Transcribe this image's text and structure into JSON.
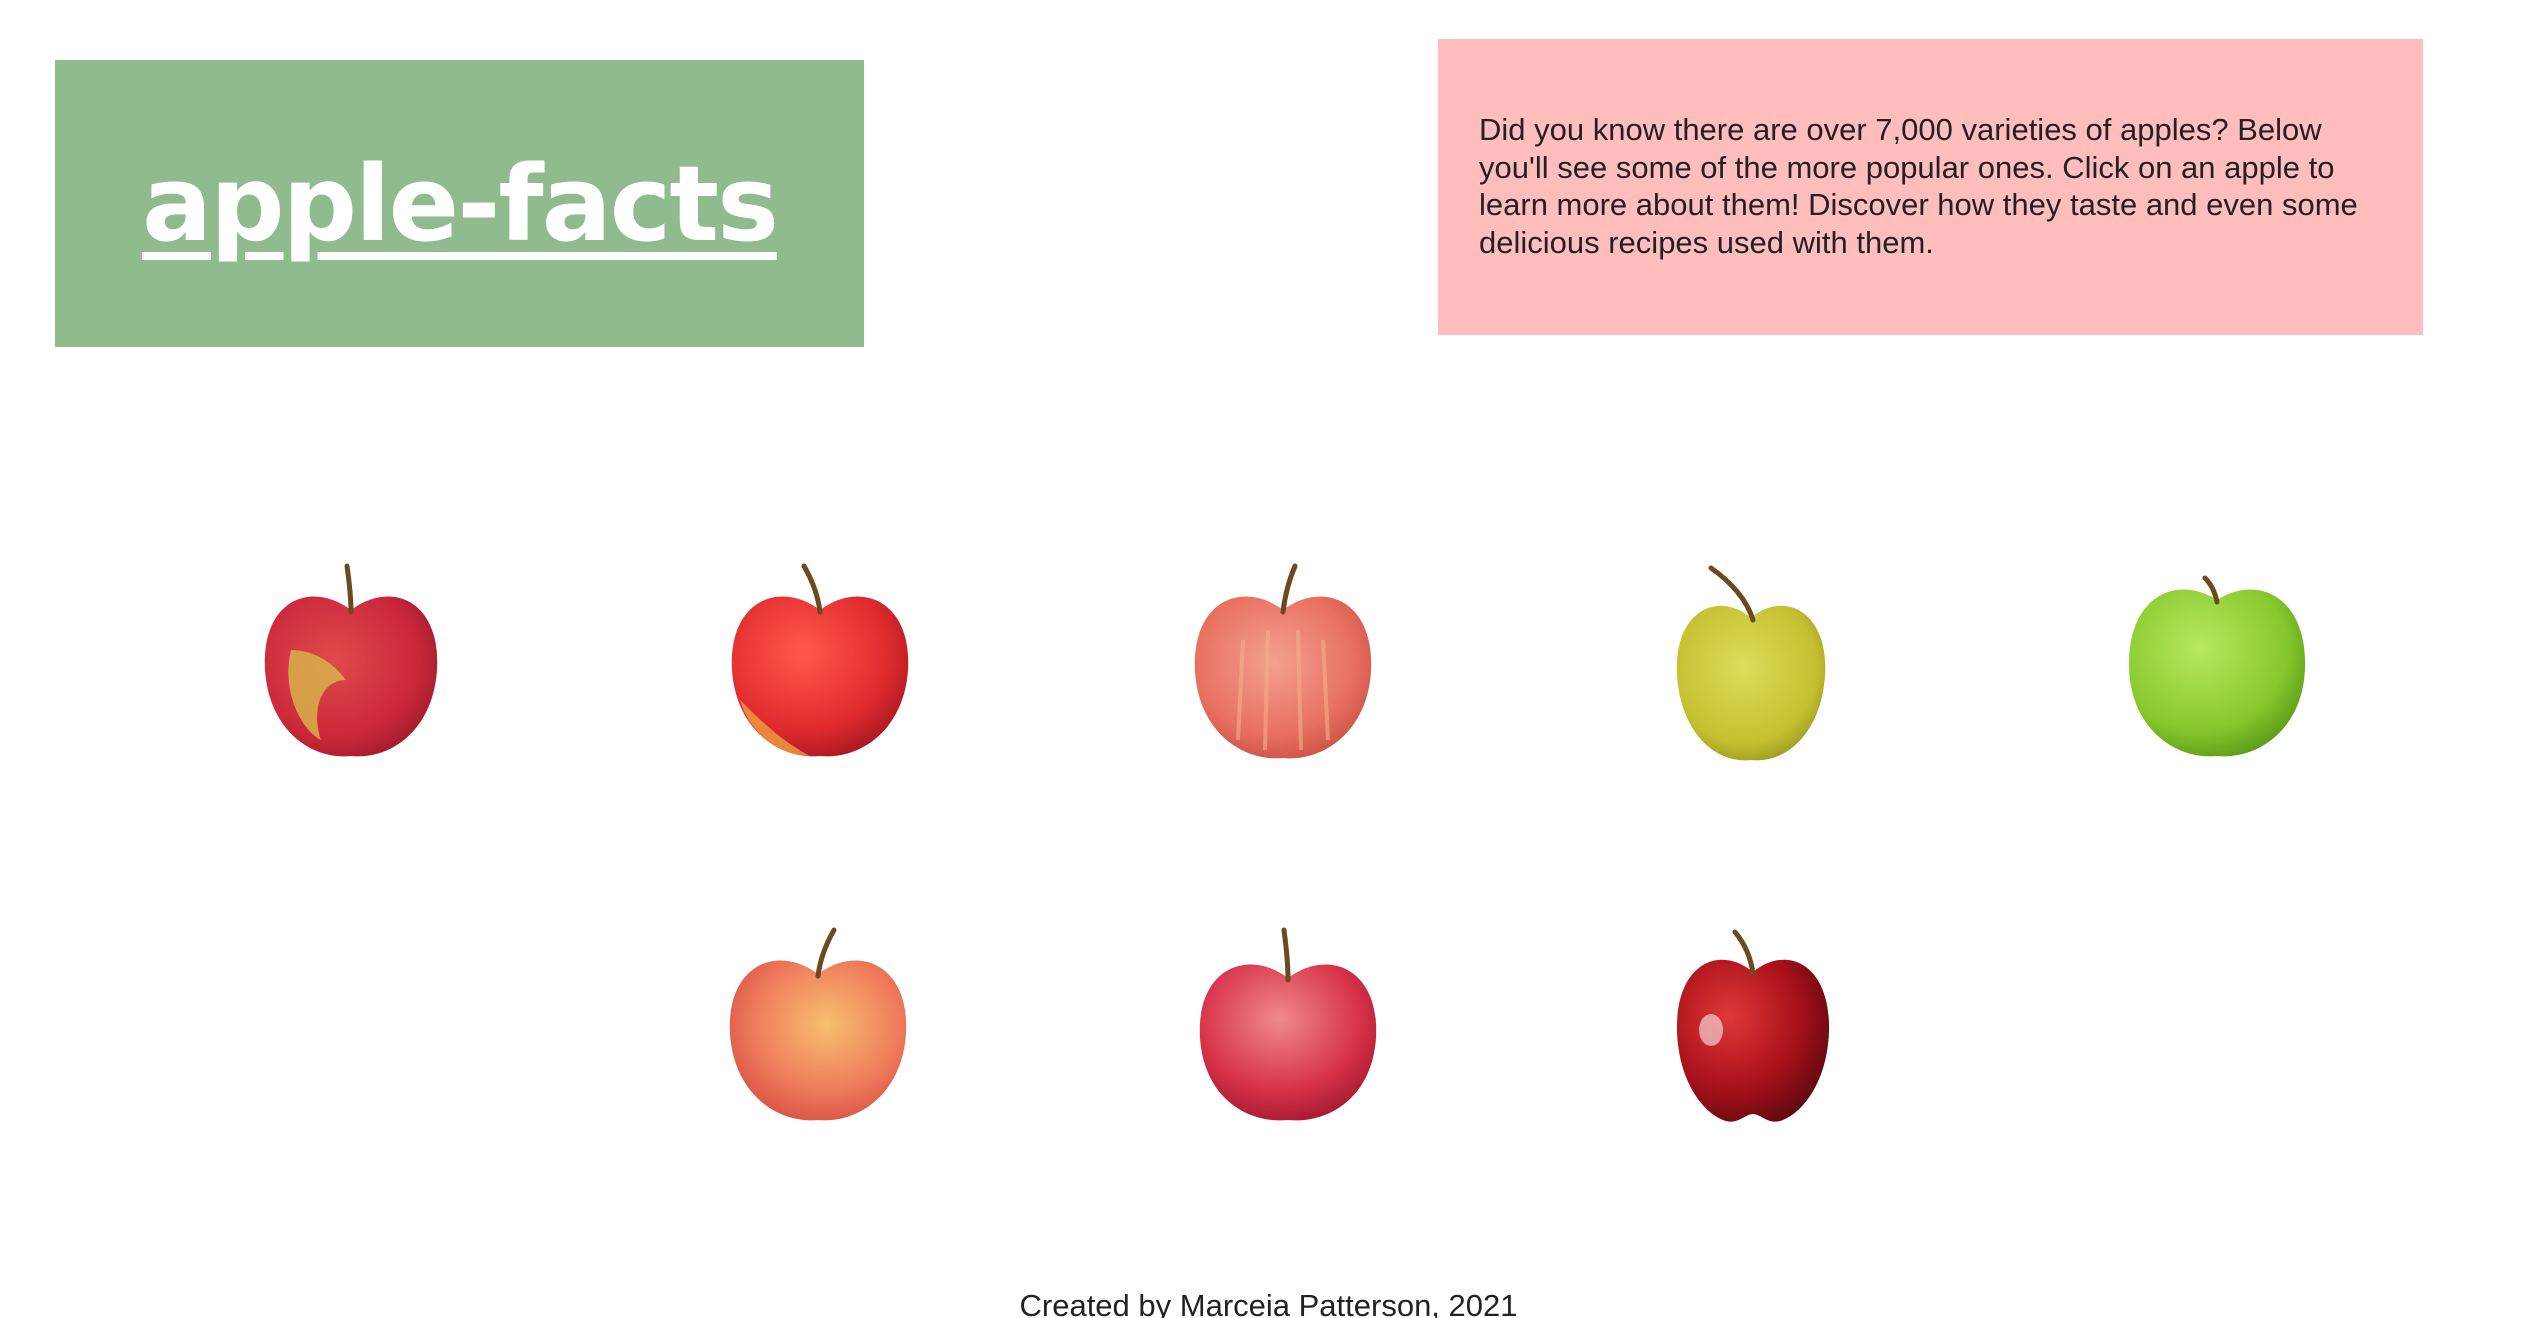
{
  "header": {
    "title": "apple-facts"
  },
  "intro": {
    "text": "Did you know there are over 7,000 varieties of apples? Below you'll see some of the more popular ones. Click on an apple to learn more about them! Discover how they taste and even some delicious recipes used with them."
  },
  "apples": [
    {
      "icon": "honeycrisp-apple-icon",
      "colors": {
        "body": "#c9283a",
        "blush": "#d8b24a"
      }
    },
    {
      "icon": "gala-apple-icon",
      "colors": {
        "body": "#e02a2e",
        "blush": "#f0a040"
      }
    },
    {
      "icon": "fuji-apple-icon",
      "colors": {
        "body": "#e8705f",
        "blush": "#f2b08a"
      }
    },
    {
      "icon": "golden-delicious-apple-icon",
      "colors": {
        "body": "#c5c030",
        "blush": "#a8a020"
      }
    },
    {
      "icon": "granny-smith-apple-icon",
      "colors": {
        "body": "#86c92c",
        "blush": "#b0e050"
      }
    },
    {
      "icon": "pink-lady-apple-icon",
      "colors": {
        "body": "#ef7a5a",
        "blush": "#f7c070"
      }
    },
    {
      "icon": "braeburn-apple-icon",
      "colors": {
        "body": "#d8324a",
        "blush": "#e8707a"
      }
    },
    {
      "icon": "red-delicious-apple-icon",
      "colors": {
        "body": "#a8101a",
        "blush": "#d03030"
      }
    }
  ],
  "footer": {
    "credit": "Created by Marceia Patterson, 2021"
  },
  "theme": {
    "title_bg": "#8fbb8f",
    "intro_bg": "#ffbdbd",
    "text": "#222222"
  }
}
